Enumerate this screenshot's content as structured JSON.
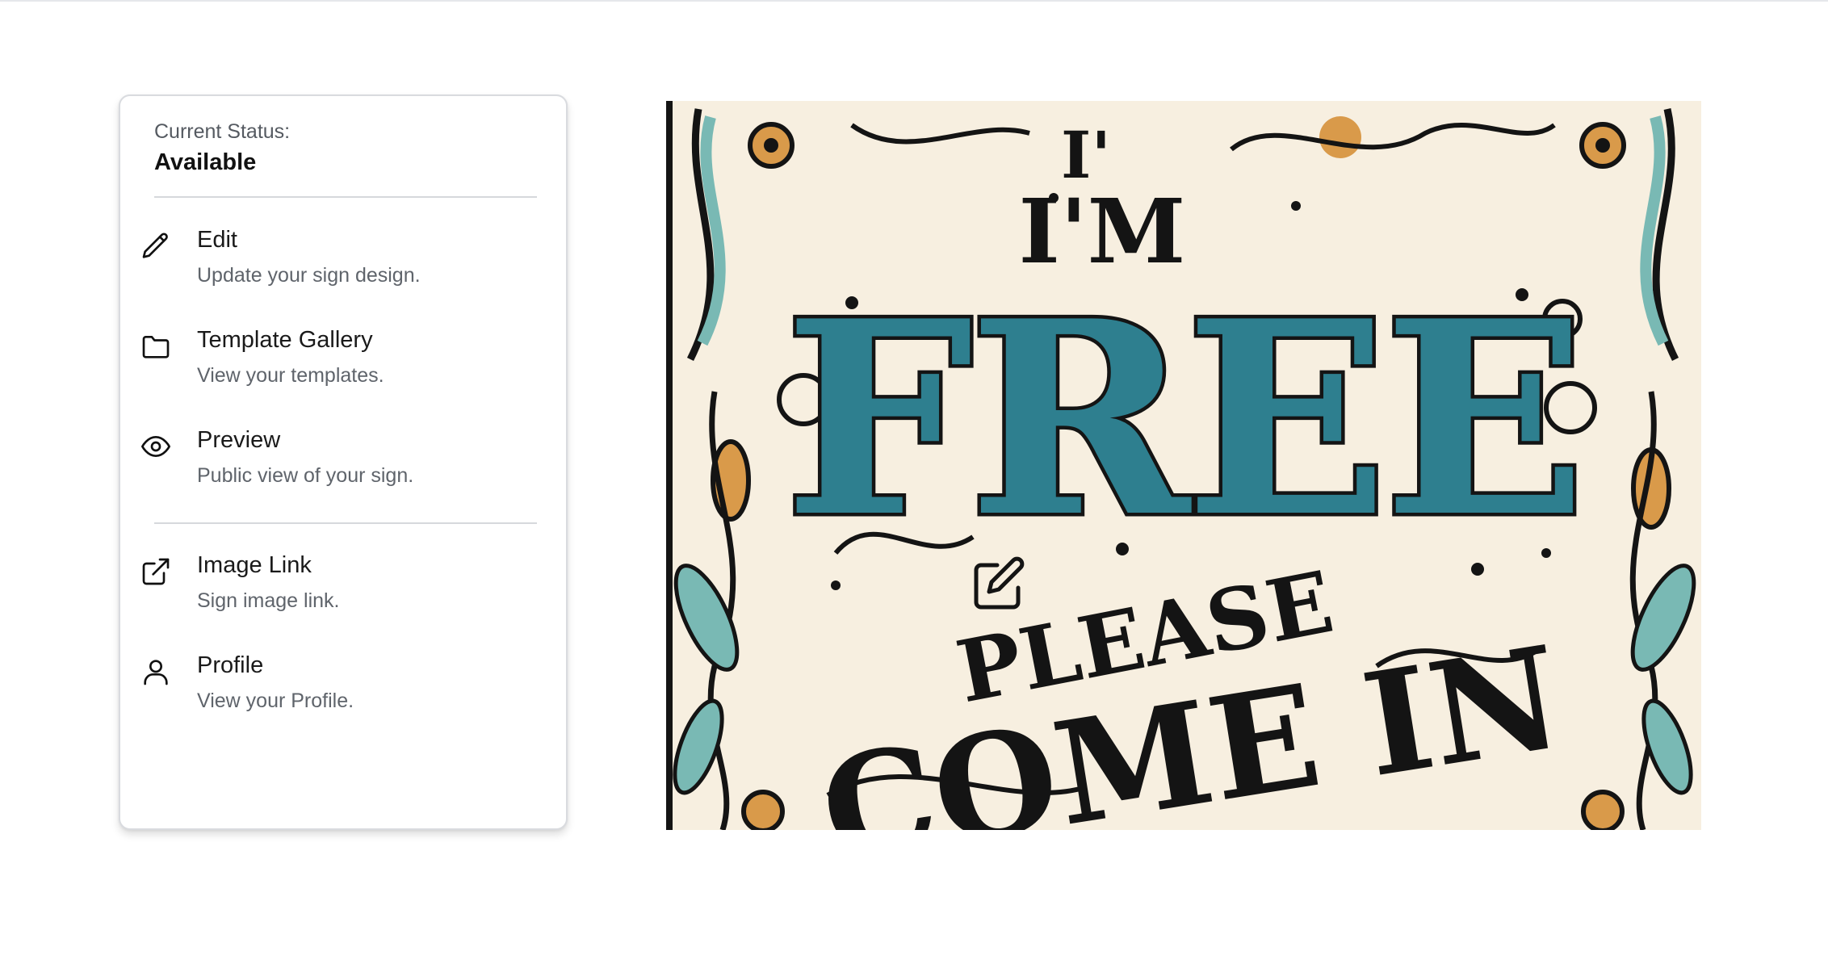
{
  "status": {
    "label": "Current Status:",
    "value": "Available"
  },
  "menu": {
    "items": [
      {
        "title": "Edit",
        "description": "Update your sign design.",
        "icon": "pencil-icon"
      },
      {
        "title": "Template Gallery",
        "description": "View your templates.",
        "icon": "folder-icon"
      },
      {
        "title": "Preview",
        "description": "Public view of your sign.",
        "icon": "eye-icon"
      },
      {
        "title": "Image Link",
        "description": "Sign image link.",
        "icon": "external-link-icon"
      },
      {
        "title": "Profile",
        "description": "View your Profile.",
        "icon": "user-icon"
      }
    ]
  },
  "sign": {
    "text_line1": "I'M",
    "text_line2": "FREE",
    "text_line3": "PLEASE",
    "text_line4": "COME IN",
    "overlay_icon": "edit-square-icon",
    "colors": {
      "background": "#f7efe0",
      "teal": "#2e7f8f",
      "teal_light": "#79b9b4",
      "ink": "#141414",
      "orange": "#d99a4a"
    }
  }
}
